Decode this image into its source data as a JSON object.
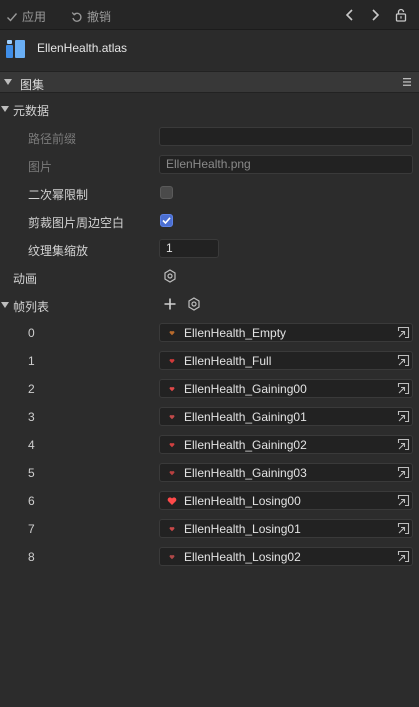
{
  "toolbar": {
    "apply_label": "应用",
    "revert_label": "撤销"
  },
  "asset": {
    "title": "EllenHealth.atlas"
  },
  "section": {
    "title": "图集"
  },
  "meta": {
    "title": "元数据",
    "path_prefix_label": "路径前缀",
    "path_prefix_value": "",
    "image_label": "图片",
    "image_value": "EllenHealth.png",
    "pot_label": "二次幂限制",
    "pot_checked": false,
    "trim_label": "剪裁图片周边空白",
    "trim_checked": true,
    "scale_label": "纹理集缩放",
    "scale_value": "1"
  },
  "animation": {
    "label": "动画"
  },
  "frames": {
    "title": "帧列表",
    "items": [
      {
        "index": "0",
        "name": "EllenHealth_Empty",
        "thumb_color": "#b86a2c"
      },
      {
        "index": "1",
        "name": "EllenHealth_Full",
        "thumb_color": "#d23a3a"
      },
      {
        "index": "2",
        "name": "EllenHealth_Gaining00",
        "thumb_color": "#e04848"
      },
      {
        "index": "3",
        "name": "EllenHealth_Gaining01",
        "thumb_color": "#c24a4a"
      },
      {
        "index": "4",
        "name": "EllenHealth_Gaining02",
        "thumb_color": "#d04040"
      },
      {
        "index": "5",
        "name": "EllenHealth_Gaining03",
        "thumb_color": "#b84040"
      },
      {
        "index": "6",
        "name": "EllenHealth_Losing00",
        "thumb_color": "#ff4a4a"
      },
      {
        "index": "7",
        "name": "EllenHealth_Losing01",
        "thumb_color": "#c84848"
      },
      {
        "index": "8",
        "name": "EllenHealth_Losing02",
        "thumb_color": "#b04848"
      }
    ]
  },
  "colors": {
    "accent": "#4b6fd2",
    "background": "#2c2c2c"
  }
}
